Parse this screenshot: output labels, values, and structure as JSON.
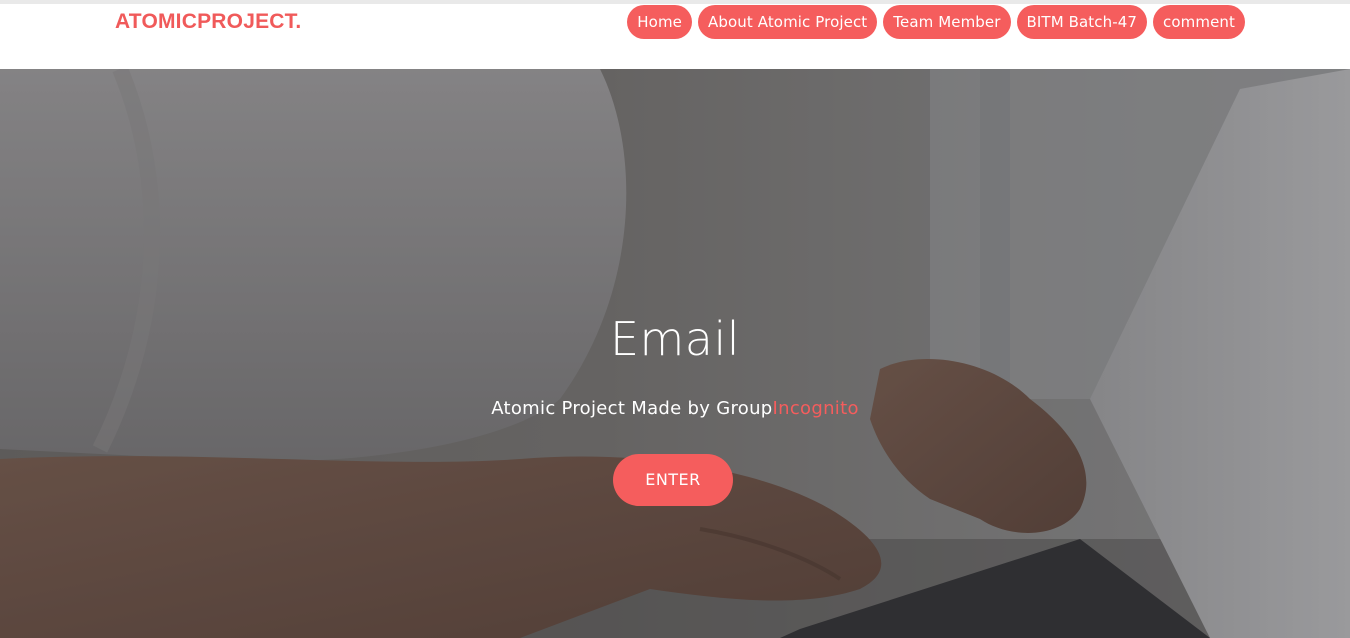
{
  "brand": "ATOMICPROJECT.",
  "nav": [
    {
      "label": "Home"
    },
    {
      "label": "About Atomic Project"
    },
    {
      "label": "Team Member"
    },
    {
      "label": "BITM Batch-47"
    },
    {
      "label": "comment"
    }
  ],
  "hero": {
    "title": "Email",
    "subtitle_prefix": "Atomic Project Made by Group",
    "subtitle_accent": "Incognito",
    "button_label": "ENTER"
  },
  "colors": {
    "accent": "#f55d5d",
    "brand": "#f05a5a"
  }
}
